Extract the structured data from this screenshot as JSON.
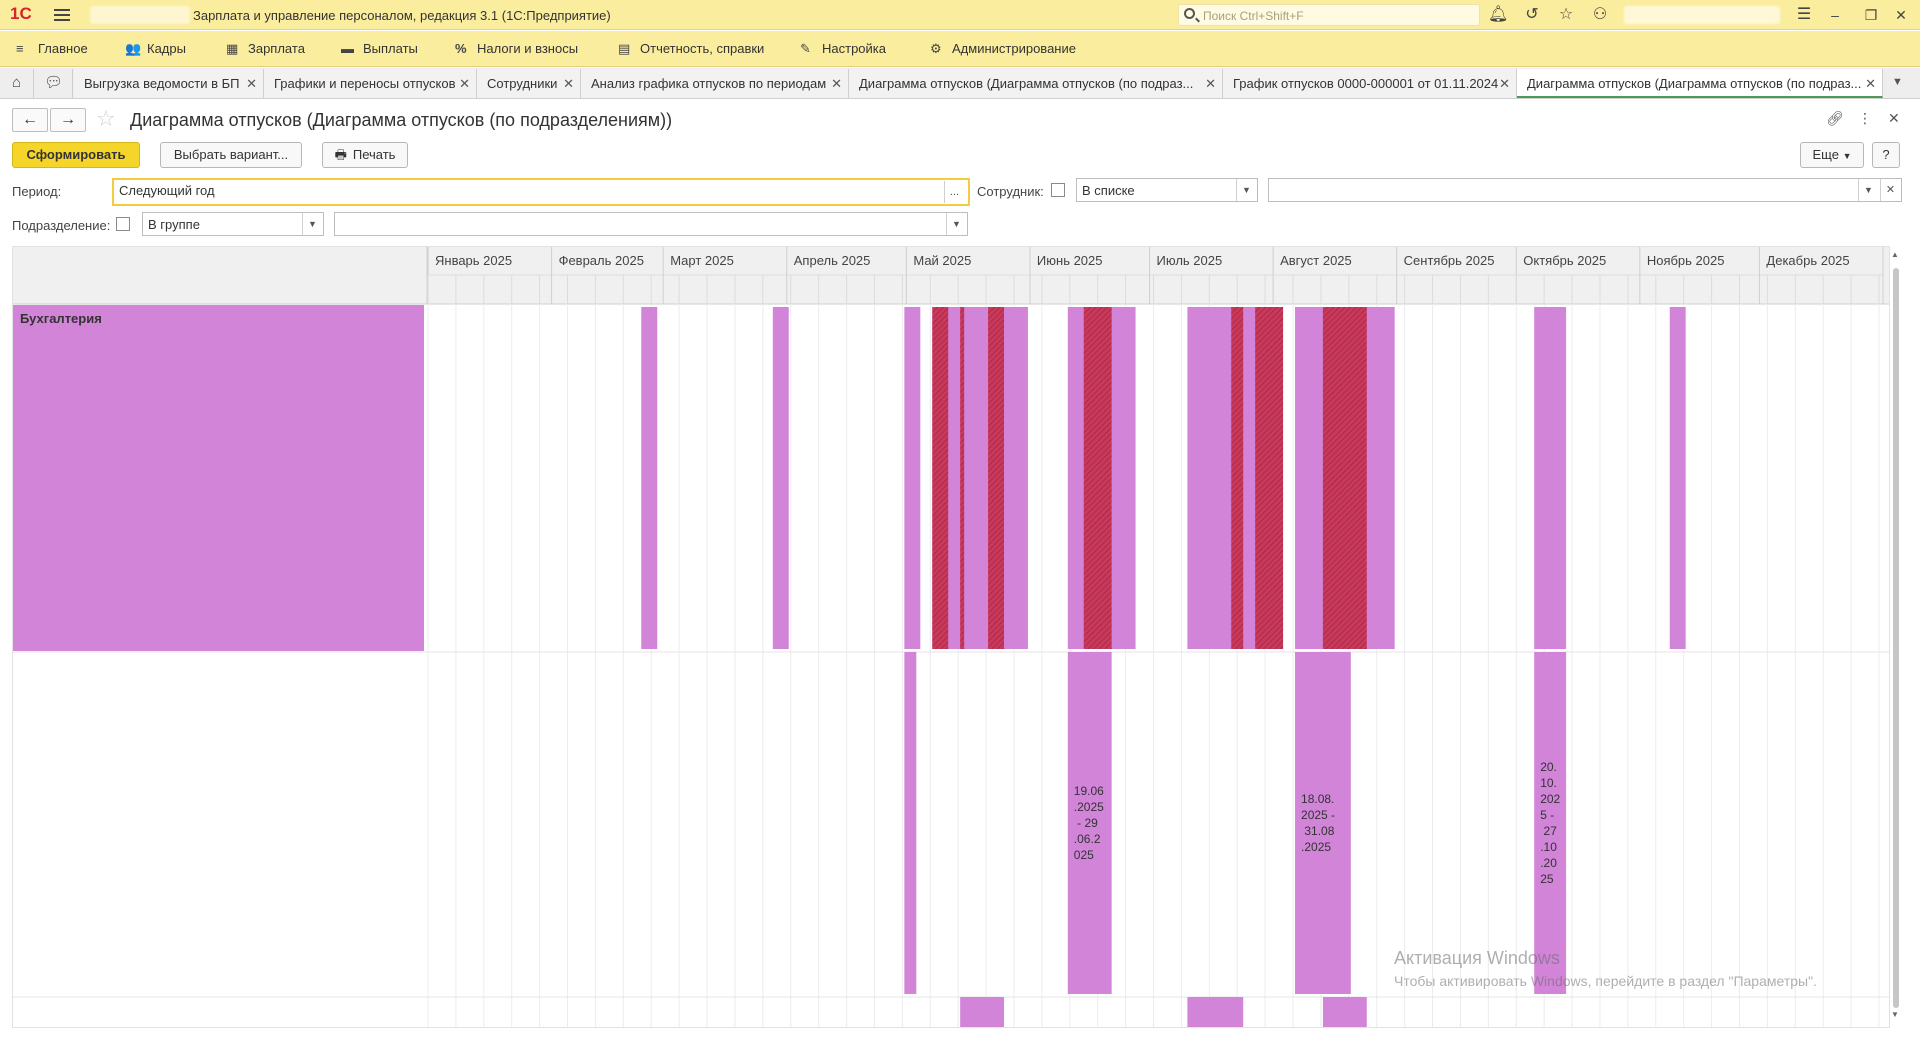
{
  "app": {
    "logo": "1С",
    "title": "Зарплата и управление персоналом, редакция 3.1  (1С:Предприятие)",
    "search_placeholder": "Поиск Ctrl+Shift+F"
  },
  "menu": [
    {
      "icon": "≡",
      "label": "Главное"
    },
    {
      "icon": "👥",
      "label": "Кадры"
    },
    {
      "icon": "▦",
      "label": "Зарплата"
    },
    {
      "icon": "▬",
      "label": "Выплаты"
    },
    {
      "icon": "%",
      "label": "Налоги и взносы"
    },
    {
      "icon": "▤",
      "label": "Отчетность, справки"
    },
    {
      "icon": "✎",
      "label": "Настройка"
    },
    {
      "icon": "⚙",
      "label": "Администрирование"
    }
  ],
  "tabs": [
    {
      "label": "Выгрузка ведомости в БП"
    },
    {
      "label": "Графики и переносы отпусков"
    },
    {
      "label": "Сотрудники"
    },
    {
      "label": "Анализ графика отпусков по периодам"
    },
    {
      "label": "Диаграмма отпусков (Диаграмма отпусков (по подраз..."
    },
    {
      "label": "График отпусков 0000-000001 от 01.11.2024"
    },
    {
      "label": "Диаграмма отпусков (Диаграмма отпусков (по подраз...",
      "active": true
    }
  ],
  "form": {
    "title": "Диаграмма отпусков (Диаграмма отпусков (по подразделениям))",
    "buttons": {
      "generate": "Сформировать",
      "variant": "Выбрать вариант...",
      "print": "Печать",
      "more": "Еще",
      "help": "?"
    },
    "period_label": "Период:",
    "period_value": "Следующий год",
    "period_dots": "...",
    "employee_label": "Сотрудник:",
    "employee_mode": "В списке",
    "department_label": "Подразделение:",
    "department_mode": "В группе"
  },
  "gantt": {
    "months": [
      "Январь 2025",
      "Февраль 2025",
      "Март 2025",
      "Апрель 2025",
      "Май 2025",
      "Июнь 2025",
      "Июль 2025",
      "Август 2025",
      "Сентябрь 2025",
      "Октябрь 2025",
      "Ноябрь 2025",
      "Декабрь 2025"
    ],
    "rows": [
      {
        "label": "Бухгалтерия",
        "group": true,
        "intervals": [
          {
            "start": 53.5,
            "end": 57.5,
            "kind": "plain"
          },
          {
            "start": 86.5,
            "end": 90.5,
            "kind": "plain"
          },
          {
            "start": 119.5,
            "end": 123.5,
            "kind": "plain"
          },
          {
            "start": 126.5,
            "end": 150.5,
            "kind": "plain"
          },
          {
            "start": 126.5,
            "end": 130.5,
            "kind": "overlap"
          },
          {
            "start": 133.5,
            "end": 134.5,
            "kind": "overlap"
          },
          {
            "start": 140.5,
            "end": 144.5,
            "kind": "overlap"
          },
          {
            "start": 160.5,
            "end": 177.5,
            "kind": "plain"
          },
          {
            "start": 164.5,
            "end": 171.5,
            "kind": "overlap"
          },
          {
            "start": 190.5,
            "end": 214.5,
            "kind": "plain"
          },
          {
            "start": 201.5,
            "end": 204.5,
            "kind": "overlap"
          },
          {
            "start": 207.5,
            "end": 214.5,
            "kind": "overlap"
          },
          {
            "start": 217.5,
            "end": 242.5,
            "kind": "plain"
          },
          {
            "start": 224.5,
            "end": 235.5,
            "kind": "overlap"
          },
          {
            "start": 277.5,
            "end": 285.5,
            "kind": "plain"
          },
          {
            "start": 311.5,
            "end": 315.5,
            "kind": "plain"
          }
        ]
      },
      {
        "label": "",
        "group": false,
        "intervals": [
          {
            "start": 119.5,
            "end": 122.5,
            "kind": "plain",
            "text": ""
          },
          {
            "start": 160.5,
            "end": 171.5,
            "kind": "plain",
            "text": "19.06.2025 - 29.06.2025"
          },
          {
            "start": 217.5,
            "end": 231.5,
            "kind": "plain",
            "text": "18.08.2025 - 31.08.2025"
          },
          {
            "start": 277.5,
            "end": 285.5,
            "kind": "plain",
            "text": "20.10.2025 - 27.10.2025"
          }
        ]
      },
      {
        "label": "",
        "group": false,
        "intervals": [
          {
            "start": 133.5,
            "end": 144.5,
            "kind": "plain"
          },
          {
            "start": 190.5,
            "end": 204.5,
            "kind": "plain"
          },
          {
            "start": 224.5,
            "end": 235.5,
            "kind": "plain"
          }
        ]
      }
    ],
    "colors": {
      "plain": "#d184d8",
      "overlap": "#c9395c",
      "header": "#f0f0f0"
    }
  },
  "watermark": {
    "line1": "Активация Windows",
    "line2": "Чтобы активировать Windows, перейдите в раздел \"Параметры\"."
  }
}
